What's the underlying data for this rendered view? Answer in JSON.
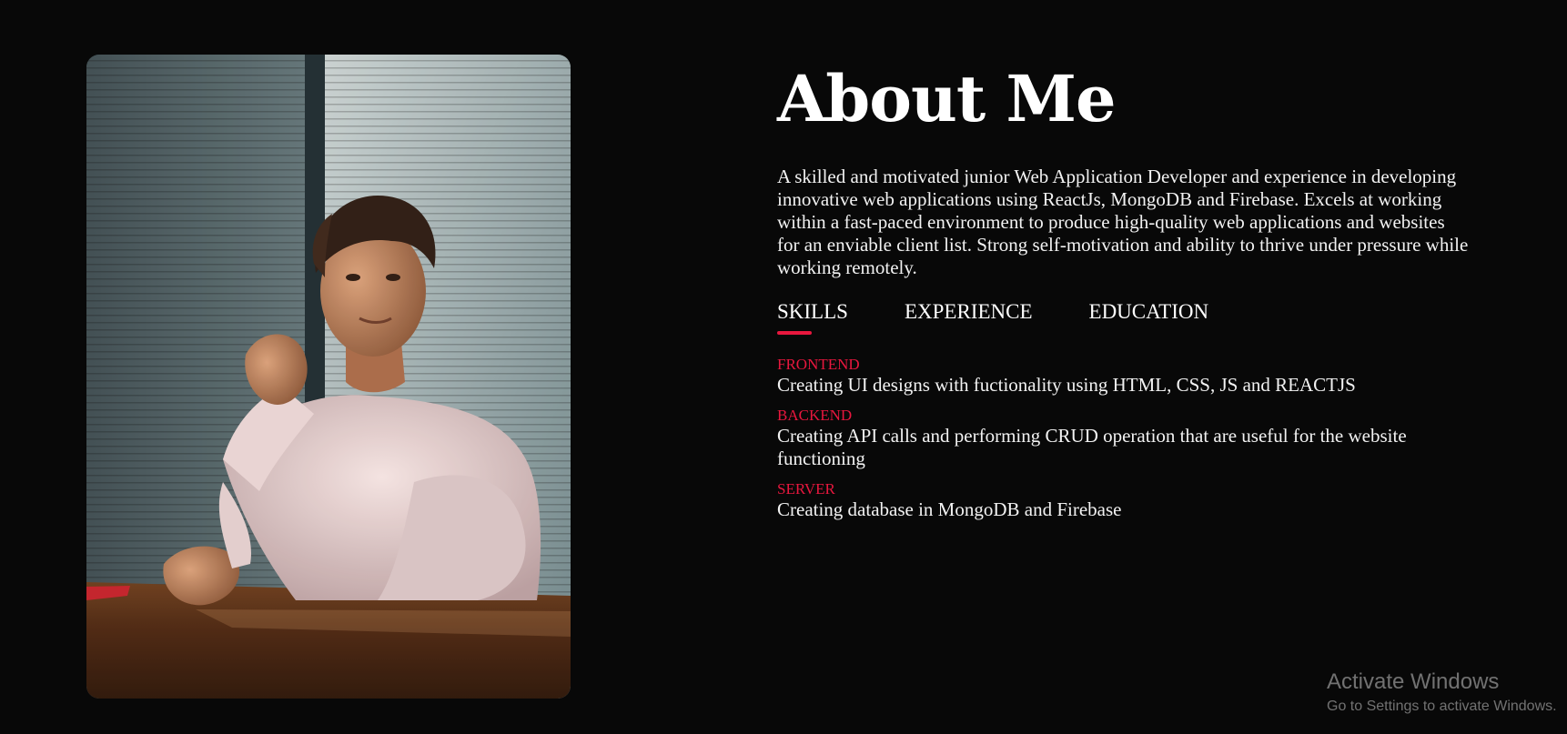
{
  "about": {
    "heading": "About Me",
    "intro": "A skilled and motivated junior Web Application Developer and experience in developing innovative web applications using ReactJs, MongoDB and Firebase. Excels at working within a fast-paced environment to produce high-quality web applications and websites for an enviable client list. Strong self-motivation and ability to thrive under pressure while working remotely."
  },
  "tabs": [
    {
      "label": "SKILLS",
      "active": true
    },
    {
      "label": "EXPERIENCE",
      "active": false
    },
    {
      "label": "EDUCATION",
      "active": false
    }
  ],
  "skills": [
    {
      "title": "FRONTEND",
      "desc": "Creating UI designs with fuctionality using HTML, CSS, JS and REACTJS"
    },
    {
      "title": "BACKEND",
      "desc": "Creating API calls and performing CRUD operation that are useful for the website functioning"
    },
    {
      "title": "SERVER",
      "desc": "Creating database in MongoDB and Firebase"
    }
  ],
  "watermark": {
    "title": "Activate Windows",
    "subtitle": "Go to Settings to activate Windows."
  },
  "colors": {
    "background": "#080808",
    "accent": "#e8173e",
    "text": "#ffffff"
  }
}
